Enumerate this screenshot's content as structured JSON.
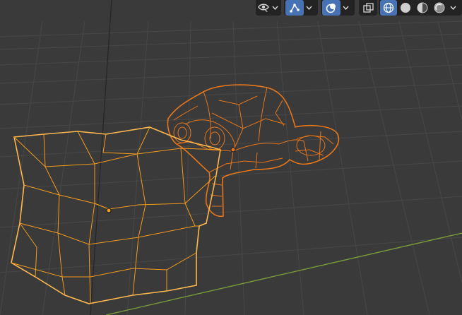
{
  "viewport": {
    "background": "#3a3a3a",
    "grid_color": "#444444",
    "selection_color": "#f29b1d",
    "active_outline_color": "#ffb84d",
    "x_axis_color": "#7a9a3a",
    "z_axis_color": "#222222"
  },
  "header": {
    "visibility_menu": {
      "icon": "eye-arrow-icon"
    },
    "gizmo_toggle": {
      "icon": "gizmo-icon",
      "active": true
    },
    "overlay_toggle": {
      "icon": "overlays-icon",
      "active": true
    },
    "xray_toggle": {
      "icon": "xray-icon",
      "active": false
    },
    "shading_modes": [
      {
        "icon": "wireframe-shading-icon",
        "active": true
      },
      {
        "icon": "solid-shading-icon",
        "active": false
      },
      {
        "icon": "material-preview-icon",
        "active": false
      },
      {
        "icon": "rendered-shading-icon",
        "active": false
      }
    ]
  },
  "objects": [
    {
      "name": "cube-mesh",
      "selected": true
    },
    {
      "name": "suzanne-mesh",
      "selected": true
    }
  ]
}
